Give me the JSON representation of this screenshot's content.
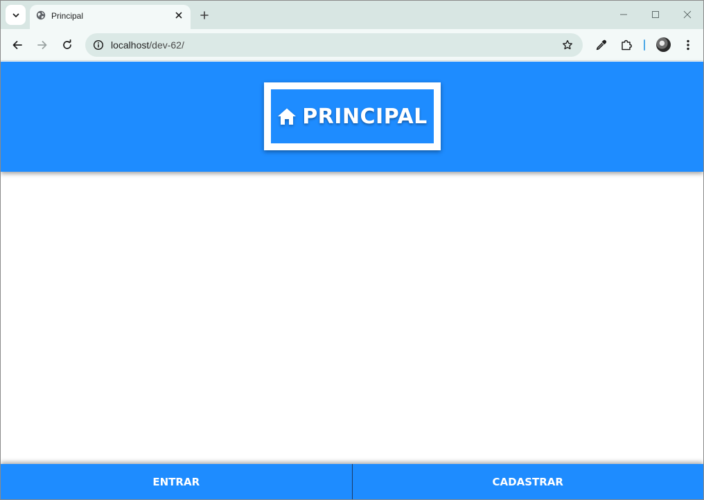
{
  "browser": {
    "tab": {
      "title": "Principal",
      "favicon": "globe-icon"
    },
    "address": {
      "host": "localhost",
      "path": "/dev-62/"
    }
  },
  "page": {
    "header": {
      "title": "PRINCIPAL",
      "icon": "home-icon"
    },
    "footer": {
      "left_label": "ENTRAR",
      "right_label": "CADASTRAR"
    }
  },
  "colors": {
    "accent": "#1e8cff",
    "tabstrip": "#d8e6e3",
    "toolbar": "#f3f9f8",
    "omnibox": "#dbe9e6"
  }
}
